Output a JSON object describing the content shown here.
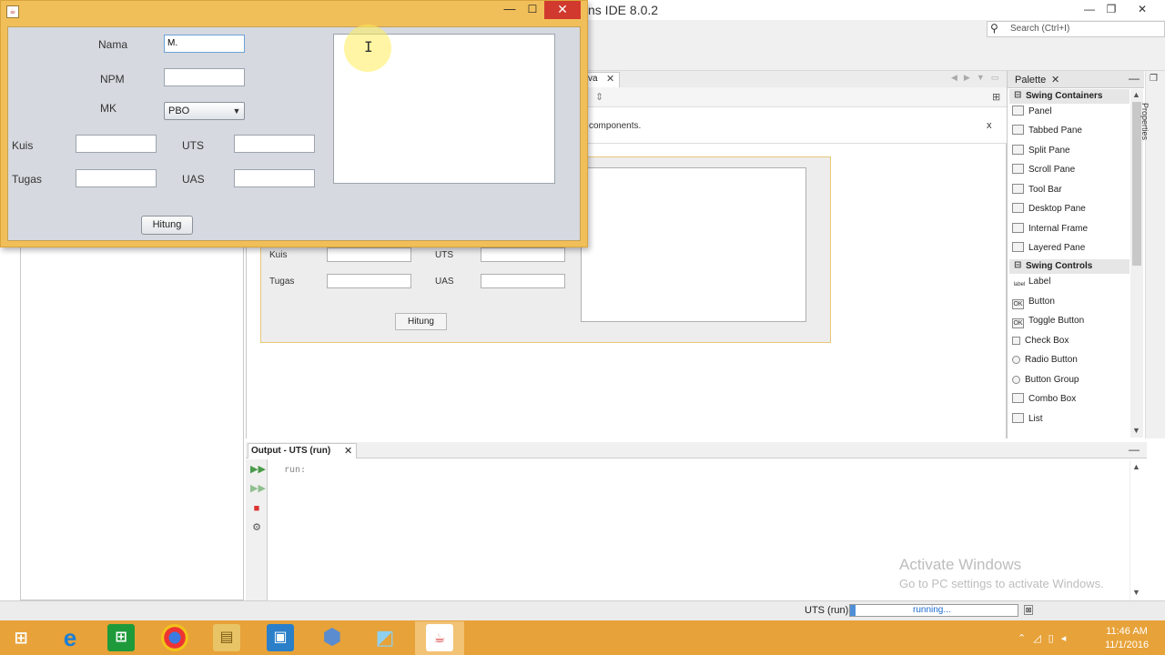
{
  "netbeans": {
    "title": "ns IDE 8.0.2",
    "window_controls": {
      "minimize": "—",
      "restore": "❐",
      "close": "✕"
    },
    "search_placeholder": "Search (Ctrl+I)",
    "editor_tab": {
      "label": "va",
      "close": "✕"
    },
    "info_text": "components.",
    "info_close": "x",
    "designer": {
      "kuis": "Kuis",
      "uts": "UTS",
      "tugas": "Tugas",
      "uas": "UAS",
      "hitung": "Hitung"
    },
    "palette": {
      "title": "Palette",
      "close": "✕",
      "minimize": "—",
      "categories": [
        {
          "sign": "⊟",
          "label": "Swing Containers"
        },
        {
          "sign": "⊟",
          "label": "Swing Controls"
        }
      ],
      "containers": [
        "Panel",
        "Tabbed Pane",
        "Split Pane",
        "Scroll Pane",
        "Tool Bar",
        "Desktop Pane",
        "Internal Frame",
        "Layered Pane"
      ],
      "controls": [
        "Label",
        "Button",
        "Toggle Button",
        "Check Box",
        "Radio Button",
        "Button Group",
        "Combo Box",
        "List"
      ],
      "label_icon": "label",
      "ok_icon": "OK"
    },
    "properties_tab": "Properties",
    "output": {
      "title": "Output - UTS (run)",
      "close": "✕",
      "minimize": "—",
      "text": "run:"
    },
    "watermark": {
      "line1": "Activate Windows",
      "line2": "Go to PC settings to activate Windows."
    },
    "status": {
      "run_label": "UTS (run)",
      "progress_text": "running...",
      "progress": 0.03
    }
  },
  "dialog": {
    "close": "✕",
    "minimize": "—",
    "maximize": "☐",
    "labels": {
      "nama": "Nama",
      "npm": "NPM",
      "mk": "MK",
      "kuis": "Kuis",
      "uts": "UTS",
      "tugas": "Tugas",
      "uas": "UAS"
    },
    "fields": {
      "nama": "M.",
      "npm": "",
      "kuis": "",
      "uts": "",
      "tugas": "",
      "uas": ""
    },
    "mk_selected": "PBO",
    "hitung_button": "Hitung"
  },
  "taskbar": {
    "time": "11:46 AM",
    "date": "11/1/2016",
    "apps": [
      "start",
      "internet-explorer",
      "store",
      "chrome",
      "file-explorer",
      "remote-desktop",
      "virtualbox",
      "notepad",
      "java"
    ]
  },
  "colors": {
    "dialog_frame": "#f1bf5a",
    "taskbar": "#e7a239",
    "close_red": "#d2392e"
  }
}
